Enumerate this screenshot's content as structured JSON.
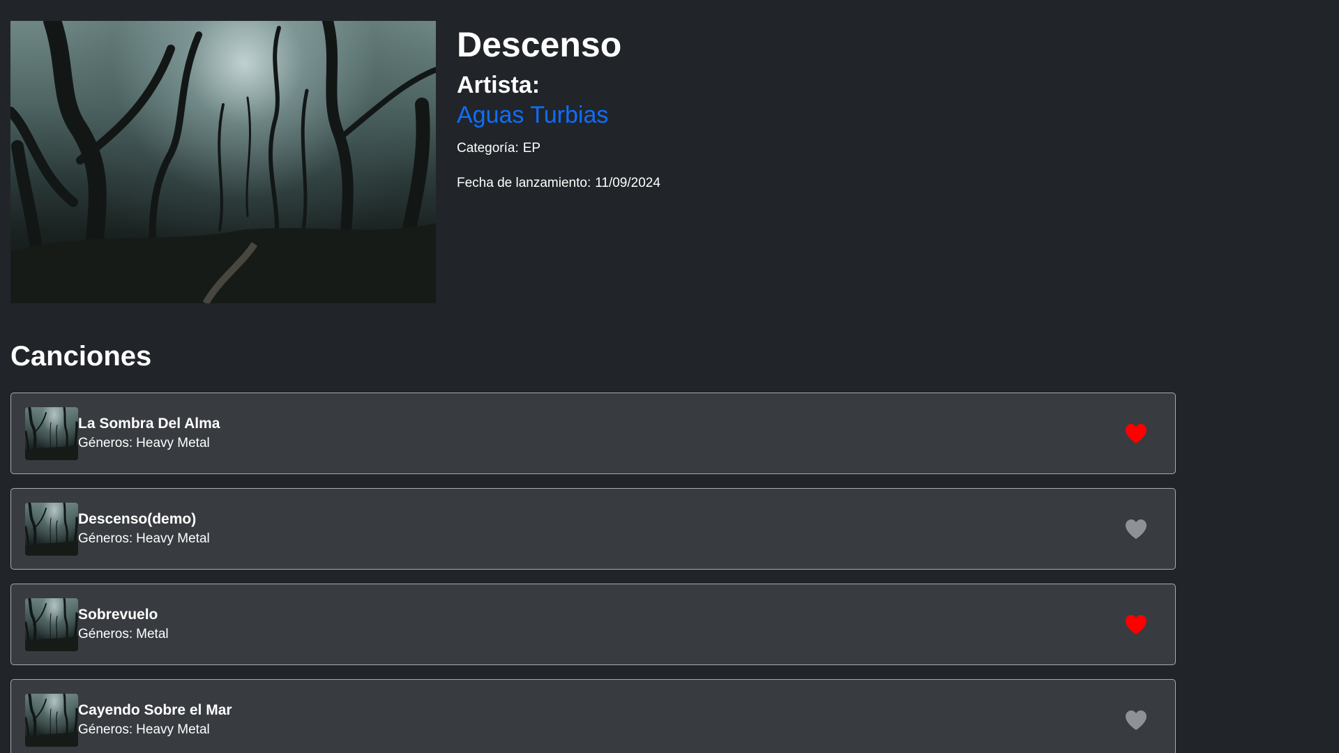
{
  "album": {
    "title": "Descenso",
    "artist_label": "Artista:",
    "artist_name": "Aguas Turbias",
    "category_label": "Categoría:",
    "category_value": "EP",
    "release_label": "Fecha de lanzamiento:",
    "release_value": "11/09/2024",
    "cover_icon": "misty-forest-image"
  },
  "songs_section": {
    "heading": "Canciones",
    "genre_label": "Géneros:",
    "items": [
      {
        "title": "La Sombra Del Alma",
        "genres": "Heavy Metal",
        "liked": true
      },
      {
        "title": "Descenso(demo)",
        "genres": "Heavy Metal",
        "liked": false
      },
      {
        "title": "Sobrevuelo",
        "genres": "Metal",
        "liked": true
      },
      {
        "title": "Cayendo Sobre el Mar",
        "genres": "Heavy Metal",
        "liked": false
      }
    ]
  },
  "colors": {
    "background": "#212529",
    "card_background": "#383b40",
    "card_border": "#a9abae",
    "link": "#0d6efd",
    "heart_liked": "#ff0000",
    "heart_unliked": "#8e9196"
  },
  "icons": {
    "heart": "heart-icon",
    "thumbnail": "forest-thumbnail"
  }
}
